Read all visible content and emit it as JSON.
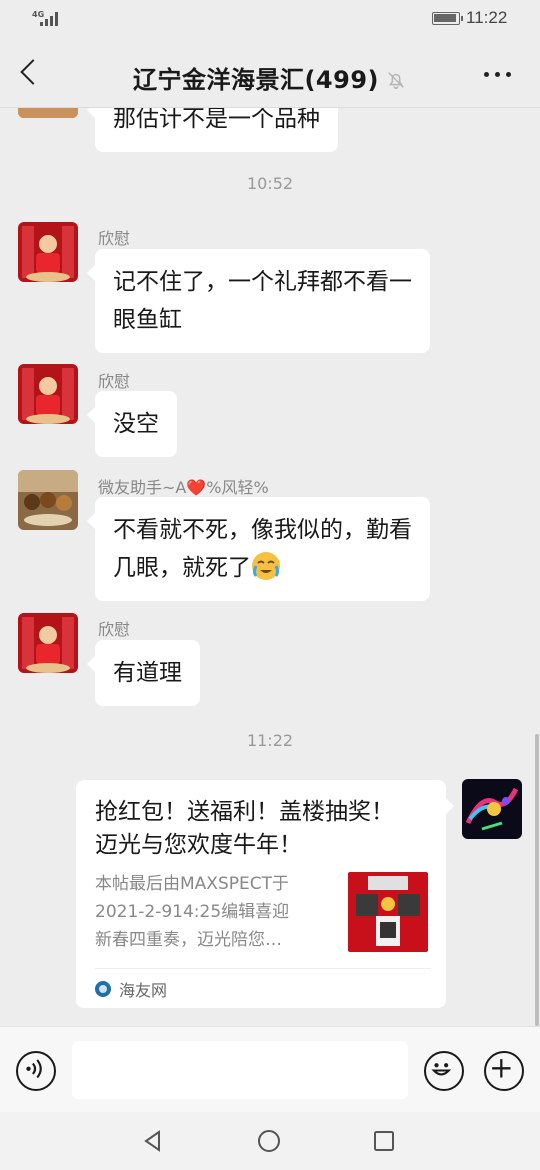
{
  "status_bar": {
    "network": "4G",
    "time": "11:22"
  },
  "header": {
    "title": "辽宁金洋海景汇(499)"
  },
  "chat": {
    "partial_message": "那估计不是一个品种",
    "messages": [
      {
        "timestamp": "10:52"
      },
      {
        "sender": "欣慰",
        "text_lines": [
          "记不住了，一个礼拜都不看一",
          "眼鱼缸"
        ]
      },
      {
        "sender": "欣慰",
        "text_lines": [
          "没空"
        ]
      },
      {
        "sender": "微友助手~A❤️%风轻%",
        "text_lines": [
          "不看就不死，像我似的，勤看",
          "几眼，就死了"
        ]
      },
      {
        "sender": "欣慰",
        "text_lines": [
          "有道理"
        ]
      },
      {
        "timestamp": "11:22"
      }
    ],
    "link_card": {
      "title_lines": [
        "抢红包！送福利！盖楼抽奖！",
        "迈光与您欢度牛年！"
      ],
      "description_lines": [
        "本帖最后由MAXSPECT于",
        "2021-2-914:25编辑喜迎",
        "新春四重奏，迈光陪您…"
      ],
      "source": "海友网"
    }
  },
  "icons": {
    "back": "chevron-left-icon",
    "mute": "bell-off-icon",
    "more": "more-dots-icon",
    "voice": "voice-icon",
    "emoji": "emoji-icon",
    "plus": "plus-icon",
    "nav_back": "triangle-back-icon",
    "nav_home": "circle-home-icon",
    "nav_recent": "square-recent-icon"
  },
  "colors": {
    "background": "#ededed",
    "bubble": "#ffffff",
    "timestamp": "#999999"
  }
}
